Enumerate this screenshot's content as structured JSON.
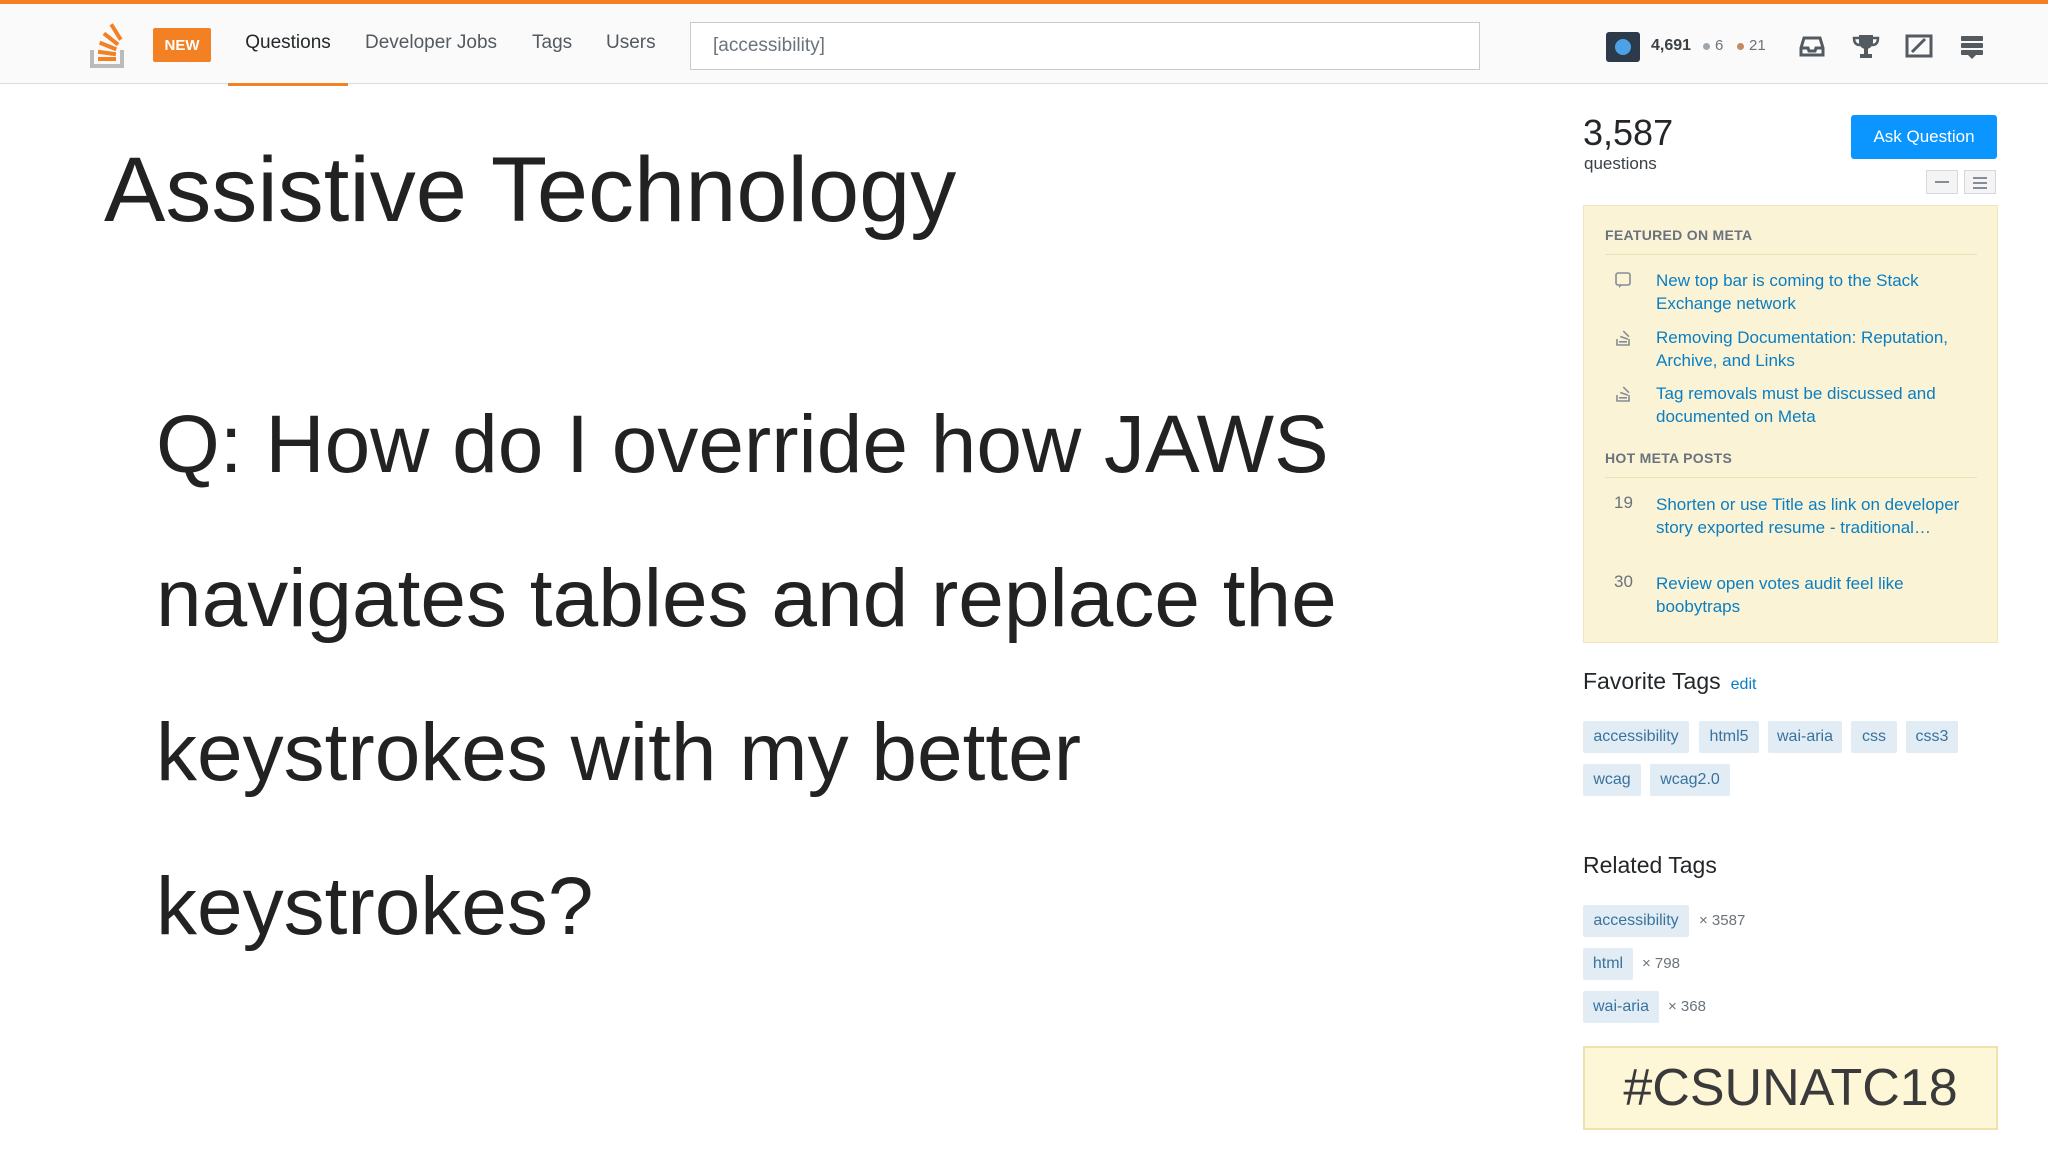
{
  "header": {
    "new_badge": "NEW",
    "nav": [
      "Questions",
      "Developer Jobs",
      "Tags",
      "Users"
    ],
    "search_value": "[accessibility]",
    "reputation": "4,691",
    "silver_badges": "6",
    "bronze_badges": "21",
    "icons": [
      "inbox-icon",
      "achievements-icon",
      "review-icon",
      "site-switcher-icon"
    ],
    "colors": {
      "accent": "#f48024",
      "silver": "#9fa6ad",
      "bronze": "#c38b5f"
    }
  },
  "slide": {
    "title": "Assistive Technology",
    "question": "Q: How do I override how JAWS navigates tables and replace the keystrokes with my better keystrokes?"
  },
  "sidebar": {
    "question_count": "3,587",
    "question_label": "questions",
    "ask_button": "Ask Question",
    "featured": {
      "heading": "FEATURED ON META",
      "items": [
        {
          "icon": "message-icon",
          "text": "New top bar is coming to the Stack Exchange network"
        },
        {
          "icon": "stackoverflow-icon",
          "text": "Removing Documentation: Reputation, Archive, and Links"
        },
        {
          "icon": "stackoverflow-icon",
          "text": "Tag removals must be discussed and documented on Meta"
        }
      ]
    },
    "hot_meta": {
      "heading": "HOT META POSTS",
      "items": [
        {
          "count": "19",
          "text": "Shorten or use Title as link on developer story exported resume - traditional…"
        },
        {
          "count": "30",
          "text": "Review open votes audit feel like boobytraps"
        }
      ]
    },
    "favorite_tags": {
      "title": "Favorite Tags",
      "edit": "edit",
      "tags": [
        "accessibility",
        "html5",
        "wai-aria",
        "css",
        "css3",
        "wcag",
        "wcag2.0"
      ]
    },
    "related_tags": {
      "title": "Related Tags",
      "tags": [
        {
          "name": "accessibility",
          "count": "× 3587"
        },
        {
          "name": "html",
          "count": "× 798"
        },
        {
          "name": "wai-aria",
          "count": "× 368"
        }
      ]
    },
    "hashtag": "#CSUNATC18"
  }
}
